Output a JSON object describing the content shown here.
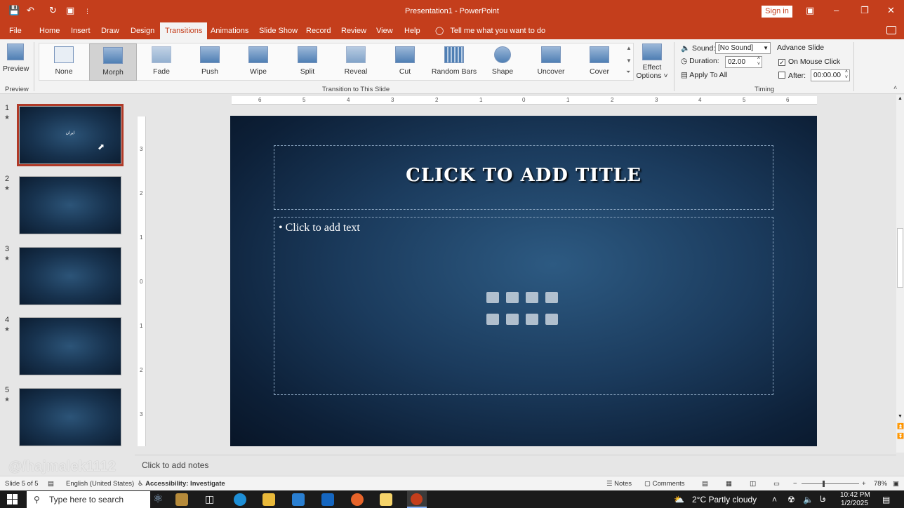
{
  "app": {
    "title": "Presentation1  -  PowerPoint",
    "sign_in": "Sign in",
    "quick_access": [
      "save-icon",
      "undo-icon",
      "redo-icon",
      "present-icon",
      "customize-icon"
    ]
  },
  "menu": {
    "tabs": [
      "File",
      "Home",
      "Insert",
      "Draw",
      "Design",
      "Transitions",
      "Animations",
      "Slide Show",
      "Record",
      "Review",
      "View",
      "Help"
    ],
    "active_tab": "Transitions",
    "tell_me": "Tell me what you want to do"
  },
  "ribbon": {
    "preview": {
      "label": "Preview",
      "group": "Preview"
    },
    "transitions": [
      {
        "label": "None"
      },
      {
        "label": "Morph"
      },
      {
        "label": "Fade"
      },
      {
        "label": "Push"
      },
      {
        "label": "Wipe"
      },
      {
        "label": "Split"
      },
      {
        "label": "Reveal"
      },
      {
        "label": "Cut"
      },
      {
        "label": "Random Bars"
      },
      {
        "label": "Shape"
      },
      {
        "label": "Uncover"
      },
      {
        "label": "Cover"
      }
    ],
    "selected_transition": "Morph",
    "effect_options": {
      "line1": "Effect",
      "line2": "Options"
    },
    "group_transition": "Transition to This Slide",
    "timing": {
      "sound_label": "Sound:",
      "sound_value": "[No Sound]",
      "duration_label": "Duration:",
      "duration_value": "02.00",
      "apply_all": "Apply To All",
      "advance_label": "Advance Slide",
      "on_mouse_click": "On Mouse Click",
      "on_mouse_click_checked": true,
      "after_label": "After:",
      "after_value": "00:00.00",
      "after_checked": false,
      "group": "Timing"
    }
  },
  "thumbnails": [
    {
      "num": "1",
      "star": "★",
      "text": "ایران",
      "selected": true
    },
    {
      "num": "2",
      "star": "★",
      "text": ""
    },
    {
      "num": "3",
      "star": "★",
      "text": ""
    },
    {
      "num": "4",
      "star": "★",
      "text": ""
    },
    {
      "num": "5",
      "star": "★",
      "text": ""
    }
  ],
  "ruler": {
    "h_ticks": [
      "6",
      "5",
      "4",
      "3",
      "2",
      "1",
      "0",
      "1",
      "2",
      "3",
      "4",
      "5",
      "6"
    ],
    "v_ticks": [
      "3",
      "2",
      "1",
      "0",
      "1",
      "2",
      "3"
    ]
  },
  "slide": {
    "title": "CLICK TO ADD TITLE",
    "body": "•  Click to add text"
  },
  "notes": {
    "placeholder": "Click to add notes",
    "watermark": "@/hajmalek1112"
  },
  "status": {
    "slide_info": "Slide 5 of 5",
    "language": "English (United States)",
    "accessibility": "Accessibility: Investigate",
    "notes": "Notes",
    "comments": "Comments",
    "zoom_minus": "−",
    "zoom_plus": "+",
    "zoom": "78%"
  },
  "taskbar": {
    "search_placeholder": "Type here to search",
    "weather": "2°C  Partly cloudy",
    "time": "10:42 PM",
    "date": "1/2/2025",
    "lang": "فا"
  }
}
